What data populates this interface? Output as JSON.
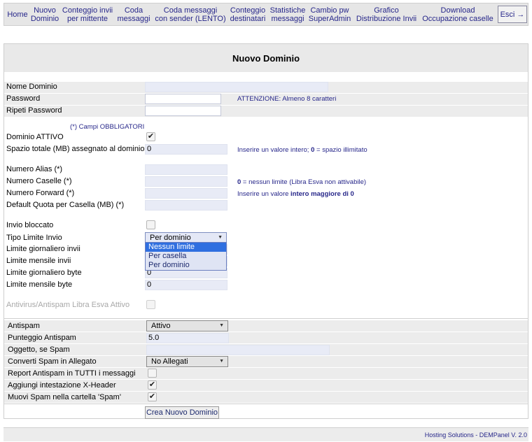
{
  "nav": {
    "items": [
      {
        "label": "Home"
      },
      {
        "label": "Nuovo\nDominio"
      },
      {
        "label": "Conteggio invii\nper mittente"
      },
      {
        "label": "Coda\nmessaggi"
      },
      {
        "label": "Coda messaggi\ncon sender (LENTO)"
      },
      {
        "label": "Conteggio\ndestinatari"
      },
      {
        "label": "Statistiche\nmessaggi"
      },
      {
        "label": "Cambio pw\nSuperAdmin"
      },
      {
        "label": "Grafico\nDistribuzione Invii"
      },
      {
        "label": "Download\nOccupazione caselle"
      }
    ],
    "logout_label": "Esci →"
  },
  "form": {
    "title": "Nuovo Dominio",
    "fields": {
      "nome_dominio": {
        "label": "Nome Dominio",
        "value": ""
      },
      "password": {
        "label": "Password",
        "value": "",
        "note": "ATTENZIONE: Almeno 8 caratteri"
      },
      "ripeti_password": {
        "label": "Ripeti Password",
        "value": ""
      },
      "required_note": "(*) Campi OBBLIGATORI",
      "dominio_attivo": {
        "label": "Dominio ATTIVO",
        "checked": true
      },
      "spazio_totale": {
        "label": "Spazio totale (MB) assegnato al dominio (*)",
        "value": "0",
        "note_pre": "Inserire un valore intero; ",
        "note_bold": "0",
        "note_post": " = spazio illimitato"
      },
      "numero_alias": {
        "label": "Numero Alias (*)",
        "value": ""
      },
      "numero_caselle": {
        "label": "Numero Caselle (*)",
        "value": "",
        "note_bold": "0",
        "note_post": " = nessun limite (Libra Esva non attivabile)"
      },
      "numero_forward": {
        "label": "Numero Forward (*)",
        "value": "",
        "note_pre": "Inserire un valore ",
        "note_bold": "intero maggiore di 0"
      },
      "default_quota": {
        "label": "Default Quota per Casella (MB) (*)",
        "value": ""
      },
      "invio_bloccato": {
        "label": "Invio bloccato",
        "checked": false
      },
      "tipo_limite_invio": {
        "label": "Tipo Limite Invio",
        "value": "Per dominio",
        "options": [
          "Nessun limite",
          "Per casella",
          "Per dominio"
        ],
        "highlighted": "Nessun limite"
      },
      "limite_giornaliero_invii": {
        "label": "Limite giornaliero invii",
        "value": "0"
      },
      "limite_mensile_invii": {
        "label": "Limite mensile invii",
        "value": "0"
      },
      "limite_giornaliero_byte": {
        "label": "Limite giornaliero byte",
        "value": "0"
      },
      "limite_mensile_byte": {
        "label": "Limite mensile byte",
        "value": "0"
      },
      "antivirus_attivo": {
        "label": "Antivirus/Antispam Libra Esva Attivo",
        "checked": false,
        "disabled": true
      }
    },
    "antispam": {
      "antispam": {
        "label": "Antispam",
        "value": "Attivo"
      },
      "punteggio": {
        "label": "Punteggio Antispam",
        "value": "5.0"
      },
      "oggetto": {
        "label": "Oggetto, se Spam",
        "value": ""
      },
      "converti": {
        "label": "Converti Spam in Allegato",
        "value": "No Allegati"
      },
      "report": {
        "label": "Report Antispam in TUTTI i messaggi",
        "checked": false
      },
      "xheader": {
        "label": "Aggiungi intestazione X-Header",
        "checked": true
      },
      "muovi": {
        "label": "Muovi Spam nella cartella 'Spam'",
        "checked": true
      }
    },
    "submit_label": "Crea Nuovo Dominio"
  },
  "footer": {
    "text": "Hosting Solutions - DEMPanel V. 2.0"
  },
  "colors": {
    "nav_text": "#27278a",
    "input_blue": "#e8ebf6",
    "dropdown_selected": "#2f6fe0"
  }
}
